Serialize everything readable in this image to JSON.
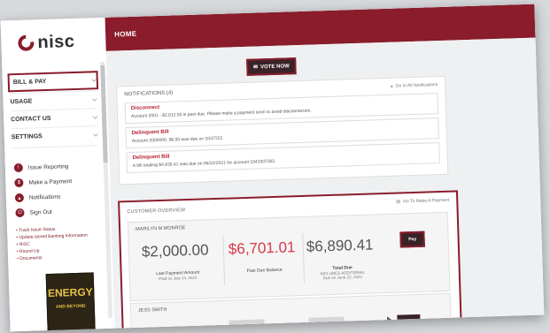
{
  "app": {
    "logo_text": "nisc",
    "header_title": "HOME"
  },
  "sidebar": {
    "nav": [
      {
        "label": "BILL & PAY",
        "selected": true
      },
      {
        "label": "USAGE",
        "selected": false
      },
      {
        "label": "CONTACT US",
        "selected": false
      },
      {
        "label": "SETTINGS",
        "selected": false
      }
    ],
    "actions": [
      {
        "label": "Issue Reporting",
        "icon": "alert-icon"
      },
      {
        "label": "Make a Payment",
        "icon": "dollar-icon"
      },
      {
        "label": "Notifications",
        "icon": "bell-icon"
      },
      {
        "label": "Sign Out",
        "icon": "power-icon"
      }
    ],
    "links": [
      "Track Issue Status",
      "Update stored Banking Information",
      "NISC",
      "Round Up",
      "Documents"
    ],
    "book": {
      "line1": "ENERGY",
      "line2": "AND BEYOND"
    }
  },
  "vote_button": {
    "label": "VOTE NOW"
  },
  "notifications": {
    "title": "NOTIFICATIONS (4)",
    "go_to_all": "Go to All Notifications",
    "items": [
      {
        "title": "Disconnect",
        "detail": "Account 2001 - $2,012.00 is past due. Please make a payment soon to avoid disconnection."
      },
      {
        "title": "Delinquent Bill",
        "detail": "Account 2000000: $6.00 was due on 10/27/22."
      },
      {
        "title": "Delinquent Bill",
        "detail": "A bill totaling $4,836.41 was due on 06/22/2021 for account 1041007302."
      }
    ]
  },
  "overview": {
    "title": "CUSTOMER OVERVIEW",
    "go_to_pay": "Go To Make A Payment",
    "accounts": [
      {
        "name": "MARILYN M MONROE",
        "last_payment": "$2,000.00",
        "last_payment_label": "Last Payment Amount",
        "last_payment_sub": "Paid on July 14, 2022",
        "past_due": "$6,701.01",
        "past_due_label": "Past Due Balance",
        "total_due": "$6,890.41",
        "total_due_label": "Total Due",
        "total_due_sub1": "INCLUDES ADDITIONAL",
        "total_due_sub2": "Due on June 22, 2022",
        "pay_label": "Pay"
      },
      {
        "name": "JESS SMITH"
      }
    ]
  },
  "colors": {
    "brand": "#8a1c2b",
    "past_due": "#d63a4a",
    "dark_button": "#3a2328"
  }
}
